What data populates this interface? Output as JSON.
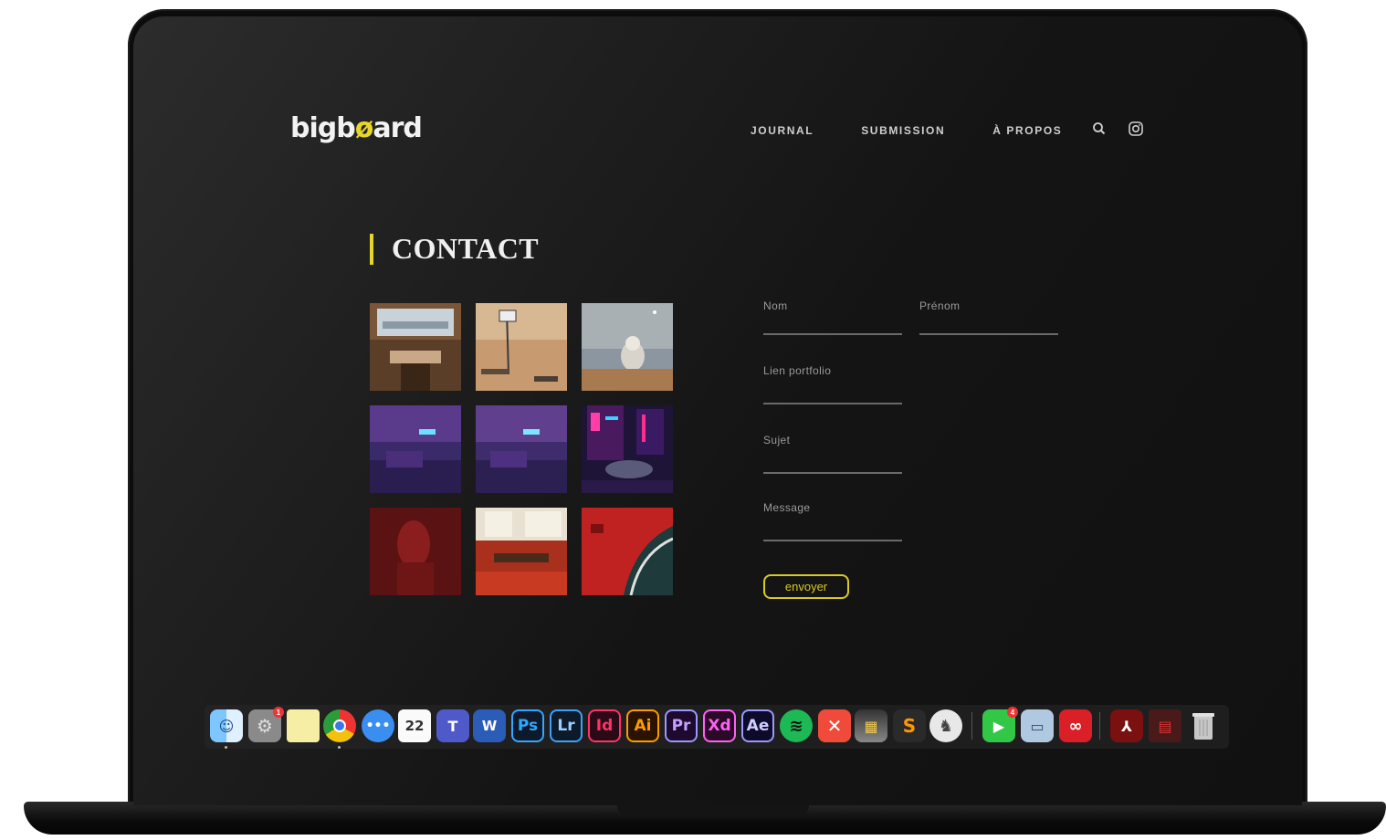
{
  "header": {
    "logo_part1": "bigb",
    "logo_accent": "ø",
    "logo_part2": "ard",
    "nav": [
      "JOURNAL",
      "SUBMISSION",
      "À PROPOS"
    ],
    "icons": [
      "search-icon",
      "instagram-icon"
    ]
  },
  "contact": {
    "title": "CONTACT",
    "gallery": [
      "room-interior",
      "desert-hoop",
      "astronaut-meadow",
      "neon-room-1",
      "neon-room-2",
      "neon-city-car",
      "red-statue",
      "red-diner",
      "red-car-window"
    ]
  },
  "form": {
    "nom_label": "Nom",
    "prenom_label": "Prénom",
    "portfolio_label": "Lien portfolio",
    "sujet_label": "Sujet",
    "message_label": "Message",
    "submit_label": "envoyer"
  },
  "dock": {
    "calendar_day": "22",
    "adobe_labels": [
      "Ps",
      "Lr",
      "Id",
      "Ai",
      "Pr",
      "Xd",
      "Ae"
    ],
    "badge_settings": "1",
    "badge_facetime": "4"
  },
  "colors": {
    "accent": "#e6d52a",
    "background": "#1a1a1a"
  }
}
